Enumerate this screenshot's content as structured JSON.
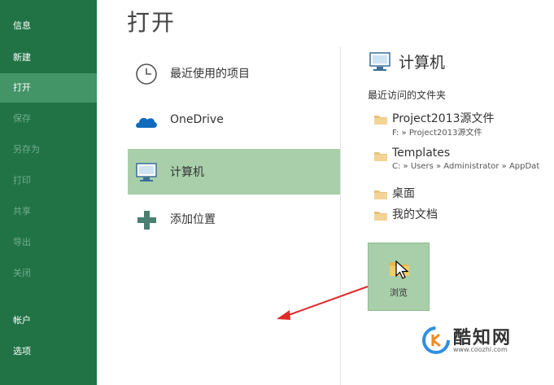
{
  "sidebar": {
    "items": [
      {
        "label": "信息"
      },
      {
        "label": "新建"
      },
      {
        "label": "打开"
      },
      {
        "label": "保存"
      },
      {
        "label": "另存为"
      },
      {
        "label": "打印"
      },
      {
        "label": "共享"
      },
      {
        "label": "导出"
      },
      {
        "label": "关闭"
      },
      {
        "label": "帐户"
      },
      {
        "label": "选项"
      }
    ]
  },
  "header": {
    "title": "打开"
  },
  "locations": [
    {
      "label": "最近使用的项目",
      "icon": "clock-icon"
    },
    {
      "label": "OneDrive",
      "icon": "cloud-icon"
    },
    {
      "label": "计算机",
      "icon": "computer-icon"
    },
    {
      "label": "添加位置",
      "icon": "plus-icon"
    }
  ],
  "right_panel": {
    "title": "计算机",
    "recent_heading": "最近访问的文件夹",
    "folders": [
      {
        "name": "Project2013源文件",
        "path": "F: » Project2013源文件"
      },
      {
        "name": "Templates",
        "path": "C: » Users » Administrator » AppDat"
      },
      {
        "name": "桌面",
        "path": ""
      },
      {
        "name": "我的文档",
        "path": ""
      }
    ],
    "browse_label": "浏览"
  },
  "watermark": {
    "text": "酷知网",
    "url": "www.coozhi.com"
  },
  "colors": {
    "sidebar_bg": "#217346",
    "sidebar_active": "#439467",
    "selected_bg": "#a8cfaa",
    "onedrive_blue": "#0f6cbd",
    "arrow_red": "#e02b2b"
  }
}
